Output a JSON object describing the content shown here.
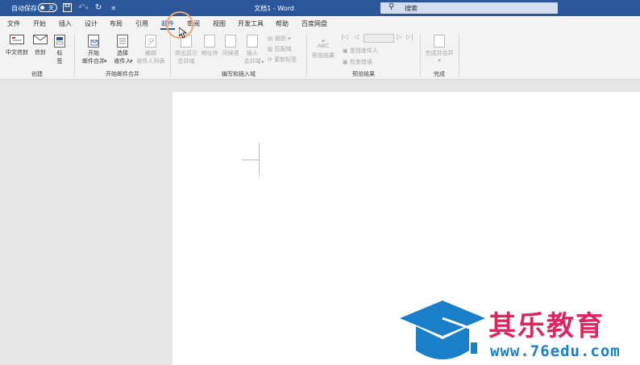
{
  "titlebar": {
    "autosave_label": "自动保存",
    "autosave_state": "关",
    "doc_title": "文档1 - Word",
    "search_placeholder": "搜索"
  },
  "tabs": [
    "文件",
    "开始",
    "插入",
    "设计",
    "布局",
    "引用",
    "邮件",
    "审阅",
    "视图",
    "开发工具",
    "帮助",
    "百度网盘"
  ],
  "active_tab": "邮件",
  "ribbon": {
    "groups": {
      "create": "创建",
      "start_merge": "开始邮件合并",
      "write_insert": "编写和插入域",
      "preview": "预览结果",
      "finish": "完成"
    },
    "create": {
      "chinese_envelope": "中文信封",
      "envelope": "信封",
      "labels_1": "标",
      "labels_2": "签"
    },
    "start_merge": {
      "start_1": "开始",
      "start_2": "邮件合并",
      "select_1": "选择",
      "select_2": "收件人",
      "edit_1": "编辑",
      "edit_2": "收件人列表"
    },
    "write_insert": {
      "highlight_1": "突出显示",
      "highlight_2": "合并域",
      "address_block": "地址块",
      "greeting": "问候语",
      "insert_1": "插入",
      "insert_2": "合并域",
      "rules": "规则",
      "match_fields": "匹配域",
      "update_labels": "更新标签"
    },
    "preview": {
      "abc": "ABC",
      "preview_results": "预览结果",
      "find_recipient": "查找收件人",
      "check_errors": "检查错误"
    },
    "finish": {
      "finish_merge": "完成并合并"
    }
  },
  "watermark": {
    "brand": "其乐教育",
    "url": "www.76edu.com"
  },
  "colors": {
    "titlebar": "#2b579a",
    "brand": "#e0245e",
    "logo_blue": "#1a7fc9"
  }
}
